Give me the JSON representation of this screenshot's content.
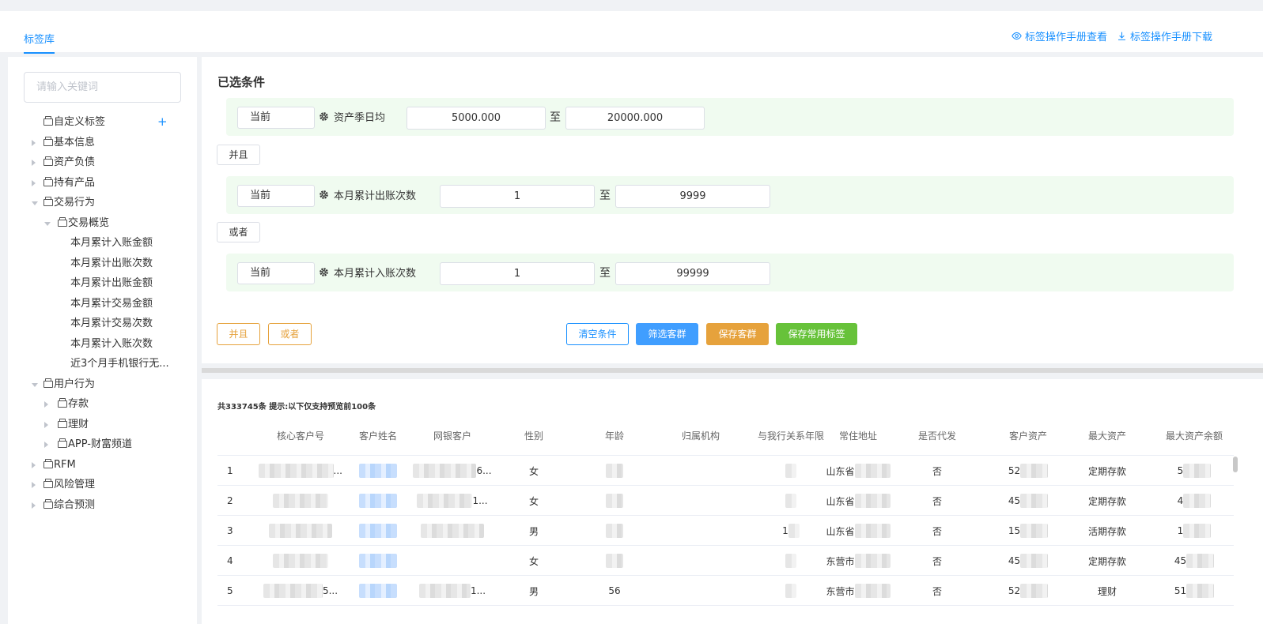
{
  "header": {
    "tab_label": "标签库",
    "manual_view": "标签操作手册查看",
    "manual_download": "标签操作手册下载"
  },
  "sidebar": {
    "search_placeholder": "请输入关键词",
    "tree": [
      {
        "label": "自定义标签",
        "level": 0,
        "caret": "none",
        "folder": true,
        "plus": "+"
      },
      {
        "label": "基本信息",
        "level": 0,
        "caret": "right",
        "folder": true
      },
      {
        "label": "资产负债",
        "level": 0,
        "caret": "right",
        "folder": true
      },
      {
        "label": "持有产品",
        "level": 0,
        "caret": "right",
        "folder": true
      },
      {
        "label": "交易行为",
        "level": 0,
        "caret": "down",
        "folder": true
      },
      {
        "label": "交易概览",
        "level": 1,
        "caret": "down",
        "folder": true
      },
      {
        "label": "本月累计入账金额",
        "level": 2,
        "caret": "none",
        "folder": false
      },
      {
        "label": "本月累计出账次数",
        "level": 2,
        "caret": "none",
        "folder": false
      },
      {
        "label": "本月累计出账金额",
        "level": 2,
        "caret": "none",
        "folder": false
      },
      {
        "label": "本月累计交易金额",
        "level": 2,
        "caret": "none",
        "folder": false
      },
      {
        "label": "本月累计交易次数",
        "level": 2,
        "caret": "none",
        "folder": false
      },
      {
        "label": "本月累计入账次数",
        "level": 2,
        "caret": "none",
        "folder": false
      },
      {
        "label": "近3个月手机银行无...",
        "level": 2,
        "caret": "none",
        "folder": false
      },
      {
        "label": "用户行为",
        "level": 0,
        "caret": "down",
        "folder": true
      },
      {
        "label": "存款",
        "level": 1,
        "caret": "right",
        "folder": true
      },
      {
        "label": "理财",
        "level": 1,
        "caret": "right",
        "folder": true
      },
      {
        "label": "APP-财富频道",
        "level": 1,
        "caret": "right",
        "folder": true
      },
      {
        "label": "RFM",
        "level": 0,
        "caret": "right",
        "folder": true
      },
      {
        "label": "风险管理",
        "level": 0,
        "caret": "right",
        "folder": true
      },
      {
        "label": "综合预测",
        "level": 0,
        "caret": "right",
        "folder": true
      }
    ]
  },
  "conditions": {
    "title": "已选条件",
    "rows": [
      {
        "period": "当前",
        "name": "资产季日均",
        "min": "5000.000",
        "max": "20000.000",
        "to": "至"
      },
      {
        "period": "当前",
        "name": "本月累计出账次数",
        "min": "1",
        "max": "9999",
        "to": "至"
      },
      {
        "period": "当前",
        "name": "本月累计入账次数",
        "min": "1",
        "max": "99999",
        "to": "至"
      }
    ],
    "logic": [
      "并且",
      "或者"
    ],
    "add_and": "并且",
    "add_or": "或者",
    "clear": "清空条件",
    "filter": "筛选客群",
    "save_group": "保存客群",
    "save_tag": "保存常用标签"
  },
  "results": {
    "summary": "共333745条 提示:以下仅支持预览前100条",
    "columns": [
      "核心客户号",
      "客户姓名",
      "网银客户",
      "性别",
      "年龄",
      "归属机构",
      "与我行关系年限",
      "常住地址",
      "是否代发",
      "客户资产",
      "最大资产",
      "最大资产余额"
    ],
    "rows": [
      {
        "no": "1",
        "core_no": "...",
        "online": "6...",
        "gender": "女",
        "age": "",
        "years": "",
        "addr": "山东省",
        "payroll": "否",
        "assets": "52",
        "max_asset": "定期存款",
        "max_bal": "5"
      },
      {
        "no": "2",
        "core_no": "",
        "online": "1...",
        "gender": "女",
        "age": "",
        "years": "",
        "addr": "山东省",
        "payroll": "否",
        "assets": "45",
        "max_asset": "定期存款",
        "max_bal": "4"
      },
      {
        "no": "3",
        "core_no": "",
        "online": "",
        "gender": "男",
        "age": "",
        "years": "1",
        "addr": "山东省",
        "payroll": "否",
        "assets": "15",
        "max_asset": "活期存款",
        "max_bal": "1"
      },
      {
        "no": "4",
        "core_no": "",
        "online": "",
        "gender": "女",
        "age": "",
        "years": "",
        "addr": "东营市",
        "payroll": "否",
        "assets": "45",
        "max_asset": "定期存款",
        "max_bal": "45"
      },
      {
        "no": "5",
        "core_no": "5...",
        "online": "1...",
        "gender": "男",
        "age": "56",
        "years": "",
        "addr": "东营市",
        "payroll": "否",
        "assets": "52",
        "max_asset": "理财",
        "max_bal": "51"
      }
    ]
  }
}
